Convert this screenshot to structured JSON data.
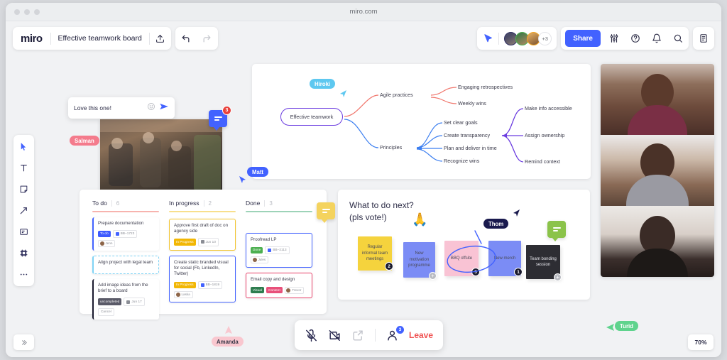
{
  "browser": {
    "url": "miro.com"
  },
  "topbar": {
    "logo": "miro",
    "board_title": "Effective teamwork board",
    "upload_icon": "upload-icon",
    "undo_icon": "undo-icon",
    "redo_icon": "redo-icon",
    "share_label": "Share",
    "avatar_overflow": "+3",
    "cursor_share_icon": "cursor-share-icon",
    "settings_icon": "sliders-icon",
    "help_icon": "help-circle-icon",
    "notifications_icon": "bell-icon",
    "search_icon": "search-icon",
    "panel_icon": "panel-icon"
  },
  "tools": [
    {
      "name": "select-tool",
      "icon": "cursor-icon",
      "active": true
    },
    {
      "name": "text-tool",
      "icon": "text-icon",
      "label": "T"
    },
    {
      "name": "sticky-note-tool",
      "icon": "sticky-note-icon"
    },
    {
      "name": "pen-tool",
      "icon": "arrow-pen-icon"
    },
    {
      "name": "template-tool",
      "icon": "template-icon"
    },
    {
      "name": "frame-tool",
      "icon": "frame-icon"
    },
    {
      "name": "more-tools",
      "icon": "ellipsis-icon"
    }
  ],
  "chat": {
    "message": "Love this one!",
    "emoji_icon": "emoji-icon",
    "send_icon": "send-icon",
    "pin_count": "3"
  },
  "mindmap": {
    "root": "Effective teamwork",
    "branches": [
      {
        "label": "Agile practices",
        "color": "#f0756b",
        "children": [
          "Engaging retrospectives",
          "Weekly wins"
        ]
      },
      {
        "label": "Principles",
        "color": "#3b7ef0",
        "children": [
          "Set clear goals",
          "Create transparency",
          "Plan and deliver in time",
          "Recognize wins"
        ]
      }
    ],
    "sub_branch": {
      "from": "Create transparency",
      "color": "#6b3ce0",
      "children": [
        "Make info accessible",
        "Assign ownership",
        "Remind context"
      ]
    }
  },
  "kanban": {
    "columns": [
      {
        "title": "To do",
        "count": "6",
        "color": "#f0756b",
        "cards": [
          {
            "title": "Prepare documentation",
            "accent": "#4262ff",
            "chips": [
              {
                "text": "To do",
                "bg": "#3d5afe",
                "type": "tag"
              },
              {
                "text": "BB–1723",
                "type": "id",
                "sq": "#4262ff"
              },
              {
                "text": "Jenn",
                "type": "avatar"
              }
            ]
          },
          {
            "title": "Align project with legal team",
            "accent": "#7fd3f5",
            "dashed": true,
            "chips": []
          },
          {
            "title": "Add image ideas from the brief to a board",
            "accent": "#1a1a2e",
            "chips": [
              {
                "text": "uncompleted",
                "bg": "#5a5a68",
                "type": "tag"
              },
              {
                "text": "Jun 17",
                "type": "date"
              },
              {
                "text": "Cancel",
                "type": "light"
              }
            ]
          }
        ]
      },
      {
        "title": "In progress",
        "count": "2",
        "color": "#f2c42e",
        "cards": [
          {
            "title": "Approve first draft of doc on agency side",
            "accent": "#f2c42e",
            "border": true,
            "chips": [
              {
                "text": "In Progress",
                "bg": "#f2b705",
                "type": "tag"
              },
              {
                "text": "Jun 10",
                "type": "date"
              }
            ]
          },
          {
            "title": "Create static branded visual for social (Fb, LinkedIn, Twitter)",
            "accent": "#4262ff",
            "border": true,
            "chips": [
              {
                "text": "In Progress",
                "bg": "#f2b705",
                "type": "tag"
              },
              {
                "text": "BB–1819",
                "type": "id",
                "sq": "#4262ff"
              },
              {
                "text": "Laska",
                "type": "avatar"
              }
            ]
          }
        ]
      },
      {
        "title": "Done",
        "count": "3",
        "color": "#4caf7d",
        "cards": [
          {
            "title": "Proofread LP",
            "accent": "#4262ff",
            "border": true,
            "chips": [
              {
                "text": "Done",
                "bg": "#4caf50",
                "type": "tag"
              },
              {
                "text": "BB–2113",
                "type": "id",
                "sq": "#4262ff"
              },
              {
                "text": "Jules",
                "type": "avatar"
              }
            ]
          },
          {
            "title": "Email copy and design",
            "accent": "#e8416a",
            "border": true,
            "chips": [
              {
                "text": "Visual",
                "bg": "#2e7d4f",
                "type": "tag"
              },
              {
                "text": "Content",
                "bg": "#e8507a",
                "type": "tag"
              },
              {
                "text": "Trevor",
                "type": "avatar"
              }
            ]
          }
        ]
      }
    ],
    "comment_pin_color": "#f4d35e"
  },
  "voteboard": {
    "title_line1": "What to do next?",
    "title_line2": "(pls vote!)",
    "emoji": "🙏",
    "comment_pin_color": "#8bc34a",
    "notes": [
      {
        "text": "Regular informal team meetings",
        "bg": "#f5d33d",
        "votes": "2"
      },
      {
        "text": "New motivation programme",
        "bg": "#7b8cf5",
        "plus": "+"
      },
      {
        "text": "BBQ offsite",
        "bg": "#f9c3d4",
        "votes": "5",
        "circled": true
      },
      {
        "text": "New merch",
        "bg": "#7b8cf5",
        "votes": "1"
      },
      {
        "text": "Team bonding session",
        "bg": "#2d2d33",
        "fg": "#e8e8ee",
        "plus": "+"
      }
    ],
    "presenter": "Thom"
  },
  "collaborators": [
    {
      "name": "Salman",
      "color": "#f47b8c"
    },
    {
      "name": "Matt",
      "color": "#4262ff"
    },
    {
      "name": "Hiroki",
      "color": "#5ec8f0"
    },
    {
      "name": "Amanda",
      "color": "#f9c7cf",
      "fg": "#3a3a4a"
    },
    {
      "name": "Turid",
      "color": "#5fd38d"
    }
  ],
  "calltoolbar": {
    "mic_icon": "mic-muted-icon",
    "camera_icon": "camera-off-icon",
    "screenshare_icon": "screen-share-icon",
    "participants_icon": "participants-icon",
    "participants_count": "3",
    "leave_label": "Leave"
  },
  "footer": {
    "collapse_icon": "collapse-icon",
    "zoom_level": "70%"
  }
}
